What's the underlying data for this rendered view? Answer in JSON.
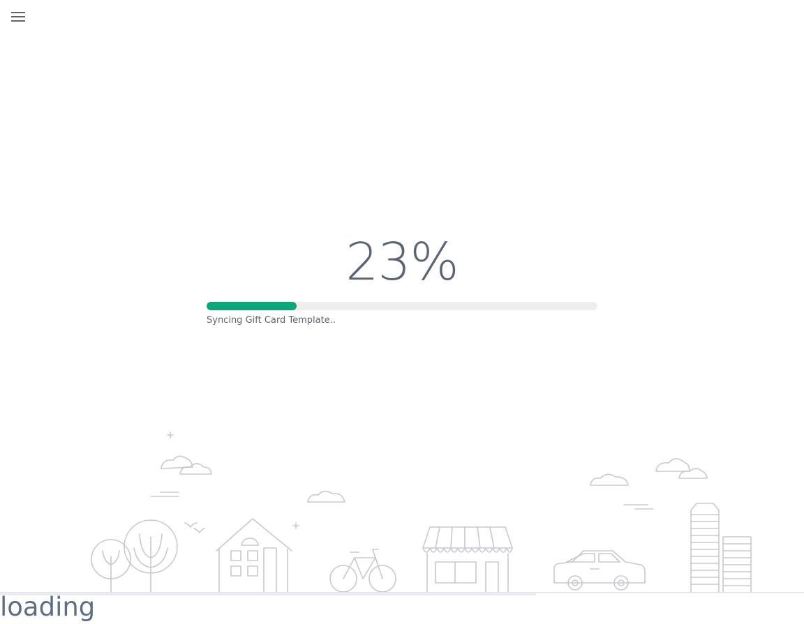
{
  "menu": {
    "icon": "hamburger-menu-icon"
  },
  "progress": {
    "percent_label": "23%",
    "value": 0.23,
    "status": "Syncing Gift Card Template..",
    "bar_color": "#0ba67a",
    "track_color": "#eeeeee"
  },
  "illustration": {
    "icons": [
      "trees-icon",
      "house-icon",
      "bicycle-icon",
      "storefront-icon",
      "car-icon",
      "buildings-icon",
      "clouds-icon",
      "birds-icon"
    ],
    "line_color": "#c5cad1"
  },
  "footer": {
    "loading_text": "loading",
    "page_progress": 0.6667
  }
}
